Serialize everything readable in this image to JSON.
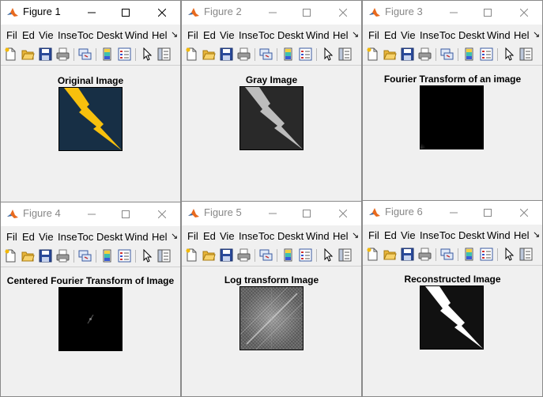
{
  "menu_labels": [
    "Fil",
    "Ed",
    "Vie",
    "Inse",
    "Toc",
    "Deskt",
    "Wind",
    "Hel"
  ],
  "menu_more_symbol": "↘",
  "toolbar_icons": [
    "new-figure-icon",
    "open-file-icon",
    "save-icon",
    "print-icon",
    "link-plot-icon",
    "insert-colorbar-icon",
    "insert-legend-icon",
    "edit-plot-arrow-icon",
    "property-inspector-icon"
  ],
  "colors": {
    "original_bg": "#172f45",
    "bolt_yellow": "#f7c00d",
    "gray_bg": "#292929",
    "gray_bolt": "#bdbdbd",
    "reconstructed_bg": "#111111",
    "titlebar_active": "#ffffff",
    "window_bg": "#f0f0f0"
  },
  "windows": [
    {
      "title": "Figure 1",
      "active": true,
      "axes_title": "Original Image",
      "image": "lightning-bolt-original-image"
    },
    {
      "title": "Figure 2",
      "active": false,
      "axes_title": "Gray Image",
      "image": "grayscale-bolt-image"
    },
    {
      "title": "Figure 3",
      "active": false,
      "axes_title": "Fourier Transform of an image",
      "image": "fourier-transform-image"
    },
    {
      "title": "Figure 4",
      "active": false,
      "axes_title": "Centered Fourier Transform of Image",
      "image": "centered-fourier-transform-image"
    },
    {
      "title": "Figure 5",
      "active": false,
      "axes_title": "Log transform Image",
      "image": "log-transform-image"
    },
    {
      "title": "Figure 6",
      "active": false,
      "axes_title": "Reconstructed Image",
      "image": "reconstructed-image"
    }
  ]
}
